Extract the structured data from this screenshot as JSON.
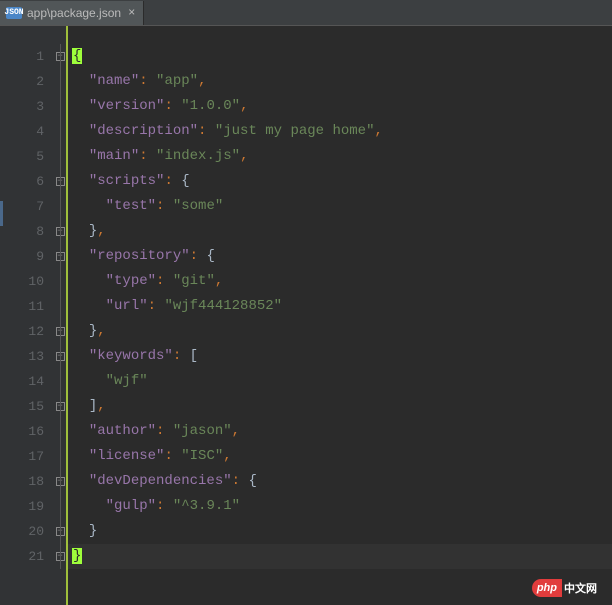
{
  "tab": {
    "icon_label": "JSON",
    "title": "app\\package.json",
    "close": "×"
  },
  "lines": [
    {
      "n": "1",
      "fold": "open",
      "content": [
        {
          "t": "cursor",
          "v": "{"
        }
      ]
    },
    {
      "n": "2",
      "fold": "line",
      "indent": 2,
      "content": [
        {
          "t": "key",
          "v": "\"name\""
        },
        {
          "t": "punct",
          "v": ": "
        },
        {
          "t": "str",
          "v": "\"app\""
        },
        {
          "t": "punct",
          "v": ","
        }
      ]
    },
    {
      "n": "3",
      "fold": "line",
      "indent": 2,
      "content": [
        {
          "t": "key",
          "v": "\"version\""
        },
        {
          "t": "punct",
          "v": ": "
        },
        {
          "t": "str",
          "v": "\"1.0.0\""
        },
        {
          "t": "punct",
          "v": ","
        }
      ]
    },
    {
      "n": "4",
      "fold": "line",
      "indent": 2,
      "content": [
        {
          "t": "key",
          "v": "\"description\""
        },
        {
          "t": "punct",
          "v": ": "
        },
        {
          "t": "str",
          "v": "\"just my page home\""
        },
        {
          "t": "punct",
          "v": ","
        }
      ]
    },
    {
      "n": "5",
      "fold": "line",
      "indent": 2,
      "content": [
        {
          "t": "key",
          "v": "\"main\""
        },
        {
          "t": "punct",
          "v": ": "
        },
        {
          "t": "str",
          "v": "\"index.js\""
        },
        {
          "t": "punct",
          "v": ","
        }
      ]
    },
    {
      "n": "6",
      "fold": "open",
      "indent": 2,
      "content": [
        {
          "t": "key",
          "v": "\"scripts\""
        },
        {
          "t": "punct",
          "v": ": "
        },
        {
          "t": "brace",
          "v": "{"
        }
      ]
    },
    {
      "n": "7",
      "fold": "line",
      "indent": 4,
      "content": [
        {
          "t": "key",
          "v": "\"test\""
        },
        {
          "t": "punct",
          "v": ": "
        },
        {
          "t": "str",
          "v": "\"some\""
        }
      ]
    },
    {
      "n": "8",
      "fold": "close",
      "indent": 2,
      "content": [
        {
          "t": "brace",
          "v": "}"
        },
        {
          "t": "punct",
          "v": ","
        }
      ],
      "activeMarker": true
    },
    {
      "n": "9",
      "fold": "open",
      "indent": 2,
      "content": [
        {
          "t": "key",
          "v": "\"repository\""
        },
        {
          "t": "punct",
          "v": ": "
        },
        {
          "t": "brace",
          "v": "{"
        }
      ]
    },
    {
      "n": "10",
      "fold": "line",
      "indent": 4,
      "content": [
        {
          "t": "key",
          "v": "\"type\""
        },
        {
          "t": "punct",
          "v": ": "
        },
        {
          "t": "str",
          "v": "\"git\""
        },
        {
          "t": "punct",
          "v": ","
        }
      ]
    },
    {
      "n": "11",
      "fold": "line",
      "indent": 4,
      "content": [
        {
          "t": "key",
          "v": "\"url\""
        },
        {
          "t": "punct",
          "v": ": "
        },
        {
          "t": "str",
          "v": "\"wjf444128852\""
        }
      ]
    },
    {
      "n": "12",
      "fold": "close",
      "indent": 2,
      "content": [
        {
          "t": "brace",
          "v": "}"
        },
        {
          "t": "punct",
          "v": ","
        }
      ]
    },
    {
      "n": "13",
      "fold": "open",
      "indent": 2,
      "content": [
        {
          "t": "key",
          "v": "\"keywords\""
        },
        {
          "t": "punct",
          "v": ": "
        },
        {
          "t": "brace",
          "v": "["
        }
      ]
    },
    {
      "n": "14",
      "fold": "line",
      "indent": 4,
      "content": [
        {
          "t": "str",
          "v": "\"wjf\""
        }
      ]
    },
    {
      "n": "15",
      "fold": "close",
      "indent": 2,
      "content": [
        {
          "t": "brace",
          "v": "]"
        },
        {
          "t": "punct",
          "v": ","
        }
      ]
    },
    {
      "n": "16",
      "fold": "line",
      "indent": 2,
      "content": [
        {
          "t": "key",
          "v": "\"author\""
        },
        {
          "t": "punct",
          "v": ": "
        },
        {
          "t": "str",
          "v": "\"jason\""
        },
        {
          "t": "punct",
          "v": ","
        }
      ]
    },
    {
      "n": "17",
      "fold": "line",
      "indent": 2,
      "content": [
        {
          "t": "key",
          "v": "\"license\""
        },
        {
          "t": "punct",
          "v": ": "
        },
        {
          "t": "str",
          "v": "\"ISC\""
        },
        {
          "t": "punct",
          "v": ","
        }
      ]
    },
    {
      "n": "18",
      "fold": "open",
      "indent": 2,
      "content": [
        {
          "t": "key",
          "v": "\"devDependencies\""
        },
        {
          "t": "punct",
          "v": ": "
        },
        {
          "t": "brace",
          "v": "{"
        }
      ]
    },
    {
      "n": "19",
      "fold": "line",
      "indent": 4,
      "content": [
        {
          "t": "key",
          "v": "\"gulp\""
        },
        {
          "t": "punct",
          "v": ": "
        },
        {
          "t": "str",
          "v": "\"^3.9.1\""
        }
      ]
    },
    {
      "n": "20",
      "fold": "close",
      "indent": 2,
      "content": [
        {
          "t": "brace",
          "v": "}"
        }
      ]
    },
    {
      "n": "21",
      "fold": "close",
      "caret": true,
      "content": [
        {
          "t": "cursor",
          "v": "}"
        }
      ]
    }
  ],
  "watermark": {
    "php": "php",
    "text": "中文网"
  }
}
